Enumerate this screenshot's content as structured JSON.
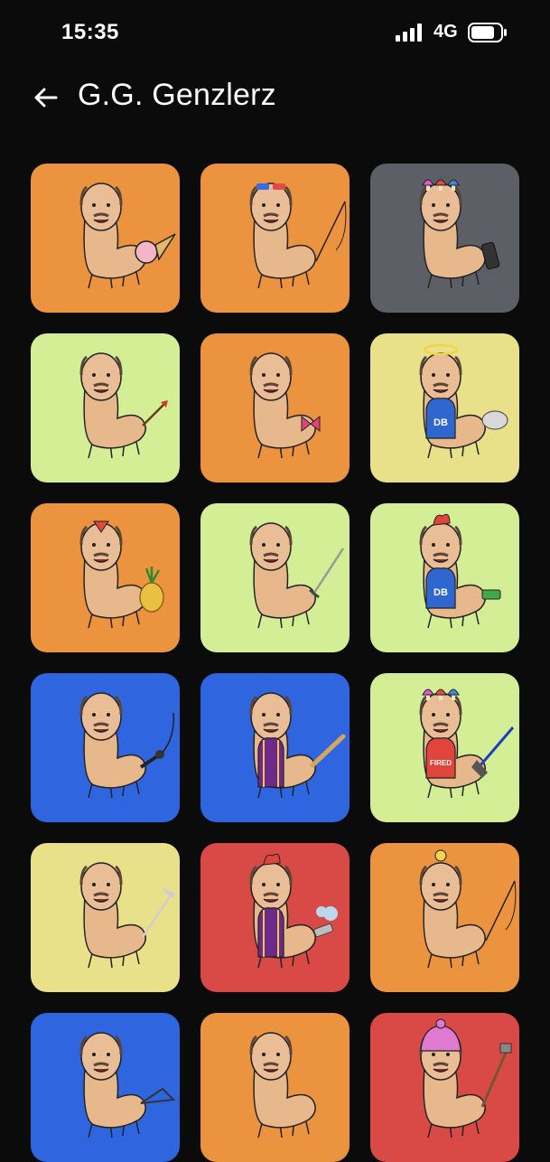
{
  "status_bar": {
    "time": "15:35",
    "network": "4G",
    "icons": [
      "signal-bars-icon",
      "battery-icon"
    ]
  },
  "header": {
    "title": "G.G. Genzlerz",
    "back_icon": "arrow-left-icon"
  },
  "colors": {
    "background": "#0b0b0c",
    "orange": "#ec9340",
    "gray": "#5d5f66",
    "lime": "#d4ee96",
    "yellow": "#e9e08a",
    "blue": "#2f66e0",
    "red": "#d94a47"
  },
  "tiles": [
    {
      "bg": "#ec9340",
      "prop": "ice-cream-cone",
      "hat": "none",
      "shirt": ""
    },
    {
      "bg": "#ec9340",
      "prop": "fishing-rod",
      "hat": "sunglasses",
      "shirt": ""
    },
    {
      "bg": "#5d5f66",
      "prop": "phone",
      "hat": "mushrooms",
      "shirt": ""
    },
    {
      "bg": "#d4ee96",
      "prop": "arrow",
      "hat": "none",
      "shirt": ""
    },
    {
      "bg": "#ec9340",
      "prop": "bow",
      "hat": "none",
      "shirt": ""
    },
    {
      "bg": "#e9e08a",
      "prop": "rock",
      "hat": "halo",
      "shirt": "DB"
    },
    {
      "bg": "#ec9340",
      "prop": "pineapple",
      "hat": "red-arrow",
      "shirt": ""
    },
    {
      "bg": "#d4ee96",
      "prop": "sword",
      "hat": "none",
      "shirt": ""
    },
    {
      "bg": "#d4ee96",
      "prop": "usb-stick",
      "hat": "chicken",
      "shirt": "DB"
    },
    {
      "bg": "#2f66e0",
      "prop": "microphone",
      "hat": "none",
      "shirt": ""
    },
    {
      "bg": "#2f66e0",
      "prop": "baseball-bat",
      "hat": "none",
      "shirt": "robe"
    },
    {
      "bg": "#d4ee96",
      "prop": "broom",
      "hat": "mushrooms",
      "shirt": "FIRED"
    },
    {
      "bg": "#e9e08a",
      "prop": "fork",
      "hat": "none",
      "shirt": ""
    },
    {
      "bg": "#d94a47",
      "prop": "spray-can",
      "hat": "chicken",
      "shirt": "robe"
    },
    {
      "bg": "#ec9340",
      "prop": "fishing-rod",
      "hat": "light-bulb",
      "shirt": ""
    },
    {
      "bg": "#2f66e0",
      "prop": "hanger",
      "hat": "none",
      "shirt": ""
    },
    {
      "bg": "#ec9340",
      "prop": "none",
      "hat": "none",
      "shirt": ""
    },
    {
      "bg": "#d94a47",
      "prop": "shovel",
      "hat": "beanie",
      "shirt": ""
    }
  ]
}
